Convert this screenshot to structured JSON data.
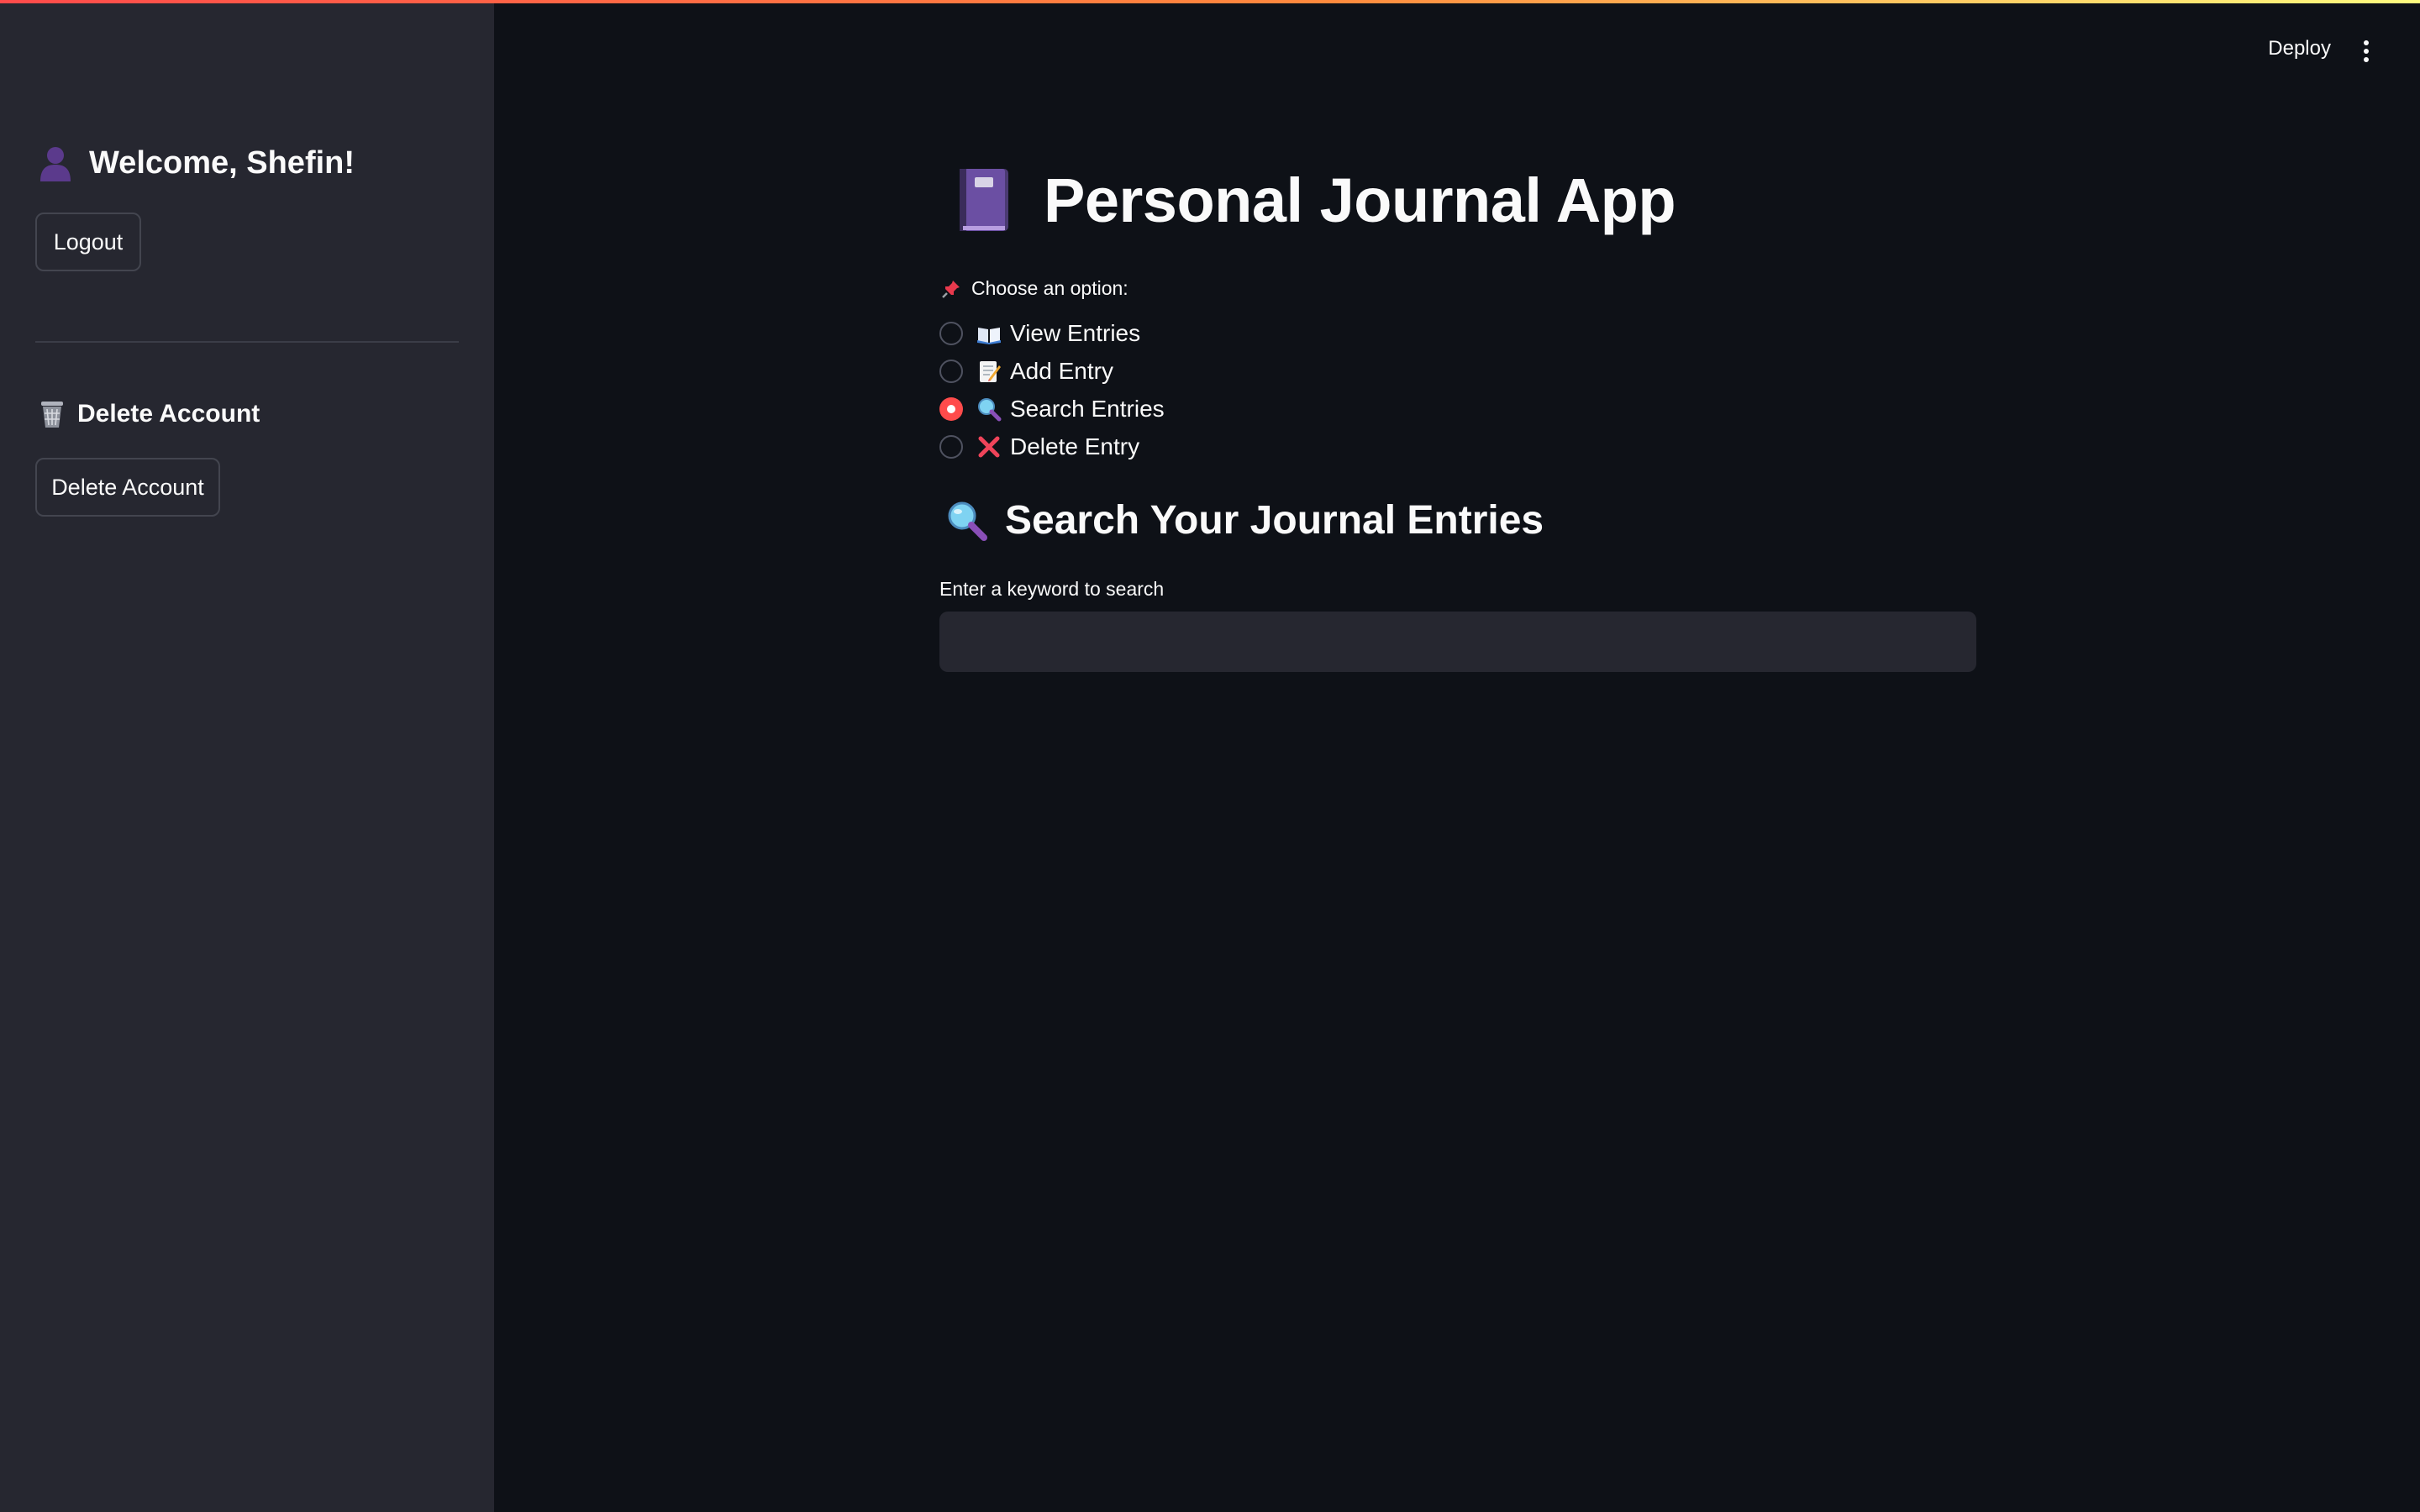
{
  "sidebar": {
    "welcome": "Welcome, Shefin!",
    "logout_label": "Logout",
    "delete_heading": "Delete Account",
    "delete_button_label": "Delete Account"
  },
  "header": {
    "deploy_label": "Deploy",
    "menu_icon": "kebab-menu-icon"
  },
  "main": {
    "title": "Personal Journal App",
    "choose_label": "Choose an option:",
    "options": [
      {
        "label": "View Entries",
        "icon": "open-book-icon",
        "selected": false
      },
      {
        "label": "Add Entry",
        "icon": "memo-icon",
        "selected": false
      },
      {
        "label": "Search Entries",
        "icon": "magnifier-icon",
        "selected": true
      },
      {
        "label": "Delete Entry",
        "icon": "cross-mark-icon",
        "selected": false
      }
    ],
    "subheading": "Search Your Journal Entries",
    "search_label": "Enter a keyword to search",
    "search_value": "",
    "search_placeholder": ""
  },
  "colors": {
    "background": "#0e1117",
    "sidebar": "#262730",
    "accent": "#ff4b4b",
    "text": "#fafafa"
  }
}
